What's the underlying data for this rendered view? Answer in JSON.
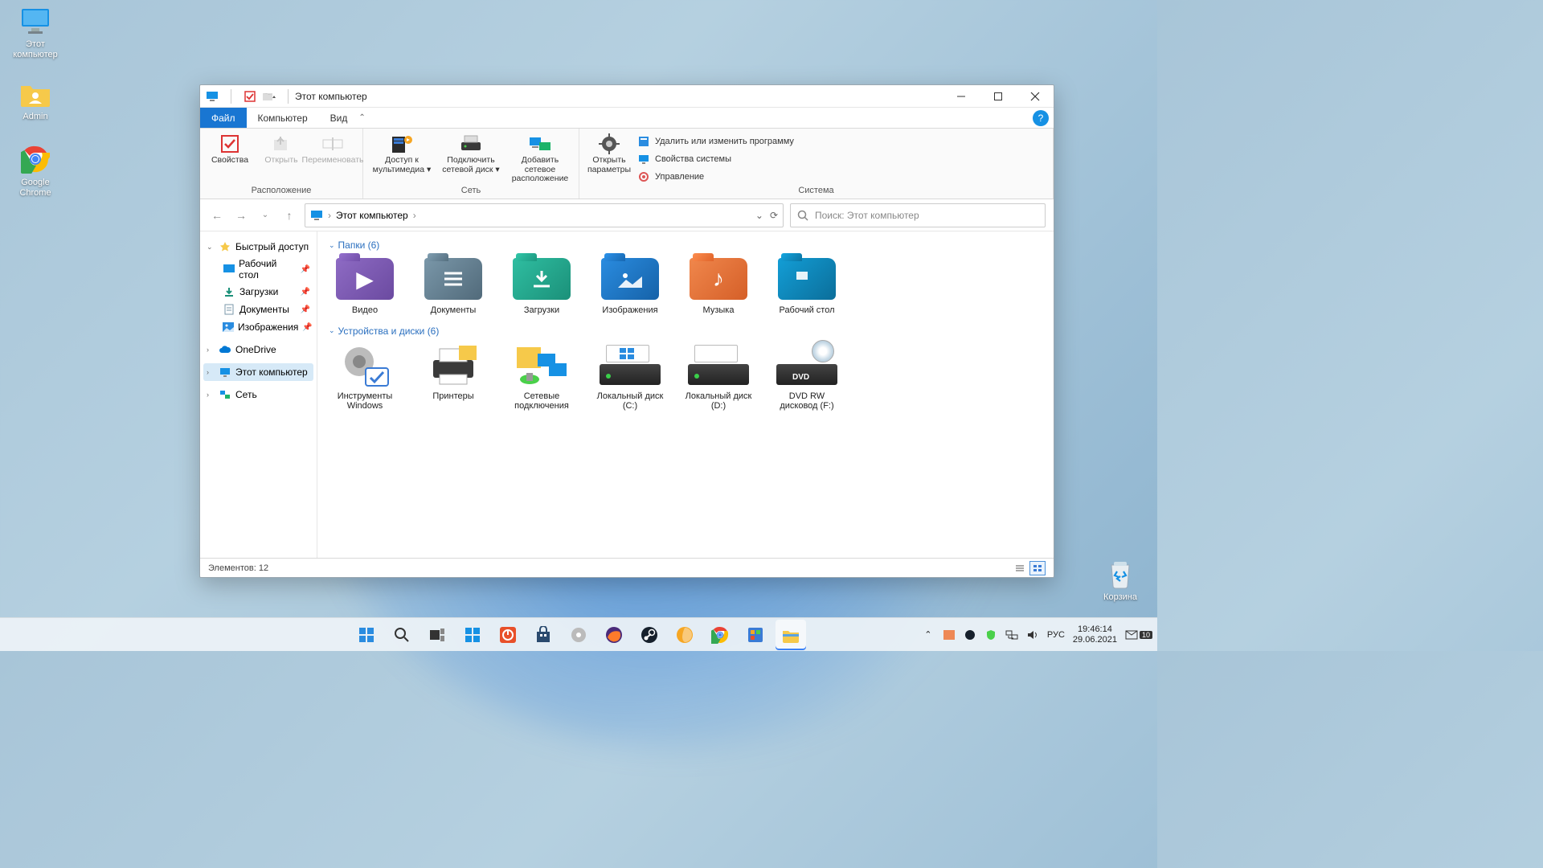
{
  "desktop_icons": {
    "this_pc": "Этот компьютер",
    "admin": "Admin",
    "chrome": "Google Chrome",
    "recycle": "Корзина"
  },
  "window": {
    "title": "Этот компьютер",
    "menu": {
      "file": "Файл",
      "computer": "Компьютер",
      "view": "Вид"
    },
    "ribbon": {
      "group_location": "Расположение",
      "group_network": "Сеть",
      "group_system": "Система",
      "properties": "Свойства",
      "open": "Открыть",
      "rename": "Переименовать",
      "media_access": "Доступ к мультимедиа",
      "map_drive": "Подключить сетевой диск",
      "add_netloc": "Добавить сетевое расположение",
      "open_settings": "Открыть параметры",
      "uninstall": "Удалить или изменить программу",
      "sys_props": "Свойства системы",
      "manage": "Управление"
    },
    "address": {
      "root": "Этот компьютер"
    },
    "search_placeholder": "Поиск: Этот компьютер",
    "sidebar": {
      "quick": "Быстрый доступ",
      "desktop": "Рабочий стол",
      "downloads": "Загрузки",
      "documents": "Документы",
      "pictures": "Изображения",
      "onedrive": "OneDrive",
      "this_pc": "Этот компьютер",
      "network": "Сеть"
    },
    "sections": {
      "folders": "Папки (6)",
      "devices": "Устройства и диски (6)"
    },
    "folders": {
      "video": "Видео",
      "documents": "Документы",
      "downloads": "Загрузки",
      "pictures": "Изображения",
      "music": "Музыка",
      "desktop": "Рабочий стол"
    },
    "devices": {
      "wintools": "Инструменты Windows",
      "printers": "Принтеры",
      "netconn": "Сетевые подключения",
      "drive_c": "Локальный диск (C:)",
      "drive_d": "Локальный диск (D:)",
      "dvd": "DVD RW дисковод (F:)"
    },
    "status": "Элементов: 12"
  },
  "taskbar": {
    "lang": "РУС",
    "time": "19:46:14",
    "date": "29.06.2021",
    "notif_count": "10"
  }
}
